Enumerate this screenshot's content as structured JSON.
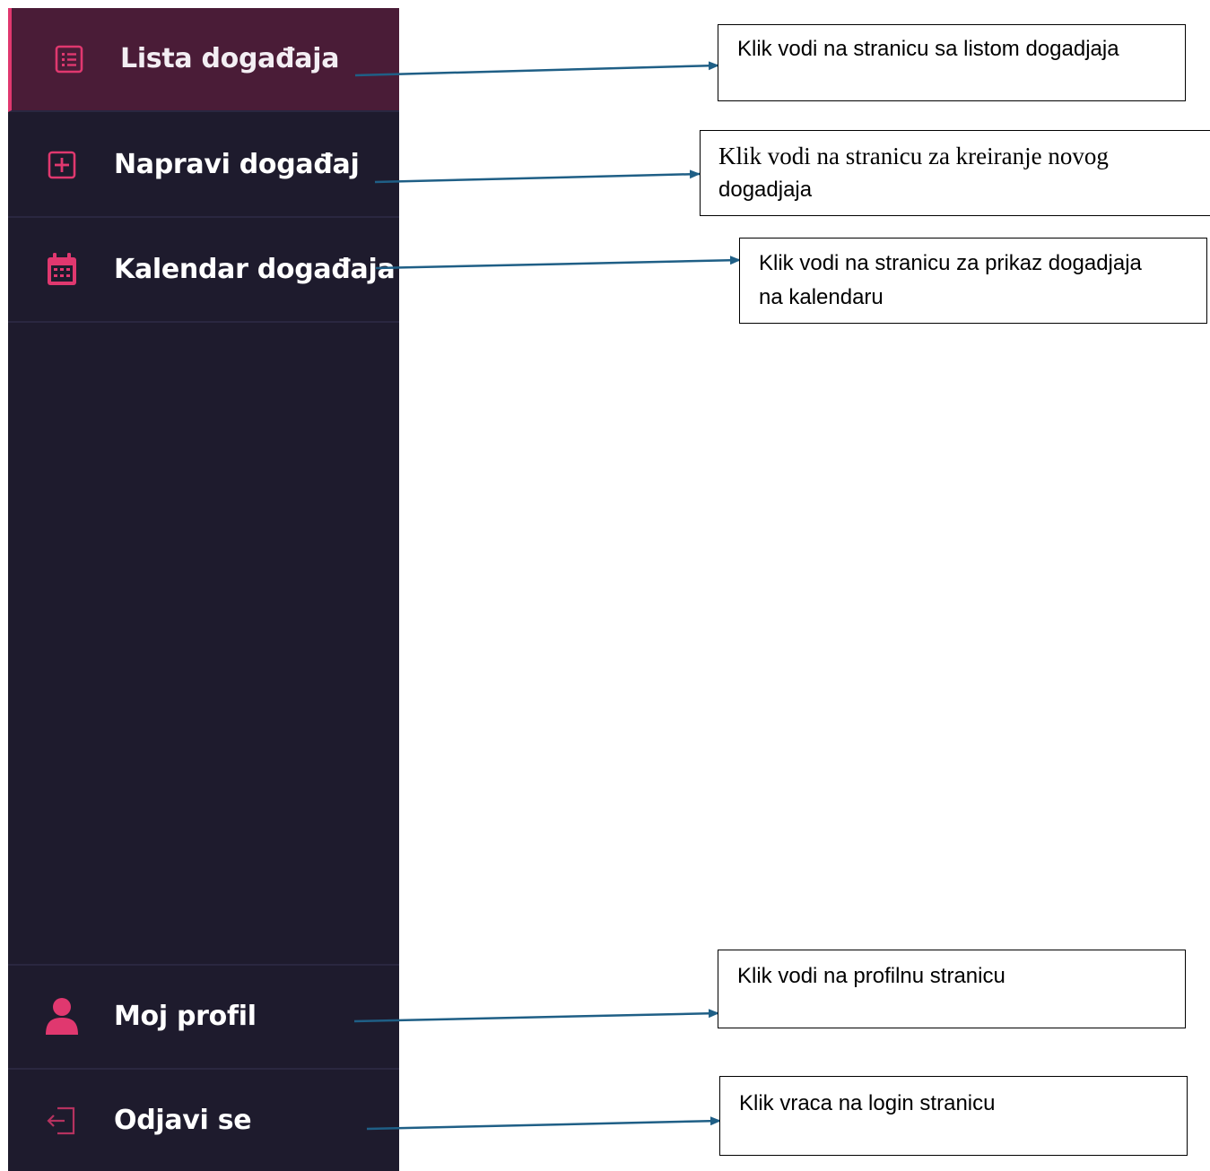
{
  "sidebar": {
    "accent_color": "#e0386f",
    "background_color": "#1e1b2d",
    "active_background_color": "#4a1c37",
    "nav": [
      {
        "label": "Lista događaja",
        "icon": "list-icon",
        "active": true
      },
      {
        "label": "Napravi događaj",
        "icon": "plus-square-icon",
        "active": false
      },
      {
        "label": "Kalendar događaja",
        "icon": "calendar-icon",
        "active": false
      }
    ],
    "bottom": [
      {
        "label": "Moj profil",
        "icon": "user-icon"
      },
      {
        "label": "Odjavi se",
        "icon": "logout-icon"
      }
    ]
  },
  "annotations": {
    "arrow_color": "#1f5f86",
    "items": [
      {
        "line1": "Klik vodi na stranicu sa listom dogadjaja",
        "line2": ""
      },
      {
        "line1": "Klik vodi na stranicu za kreiranje novog",
        "line2": "dogadjaja"
      },
      {
        "line1": "Klik vodi na stranicu za prikaz dogadjaja",
        "line2": "na kalendaru"
      },
      {
        "line1": "Klik vodi na profilnu stranicu",
        "line2": ""
      },
      {
        "line1": "Klik vraca na login stranicu",
        "line2": ""
      }
    ]
  }
}
